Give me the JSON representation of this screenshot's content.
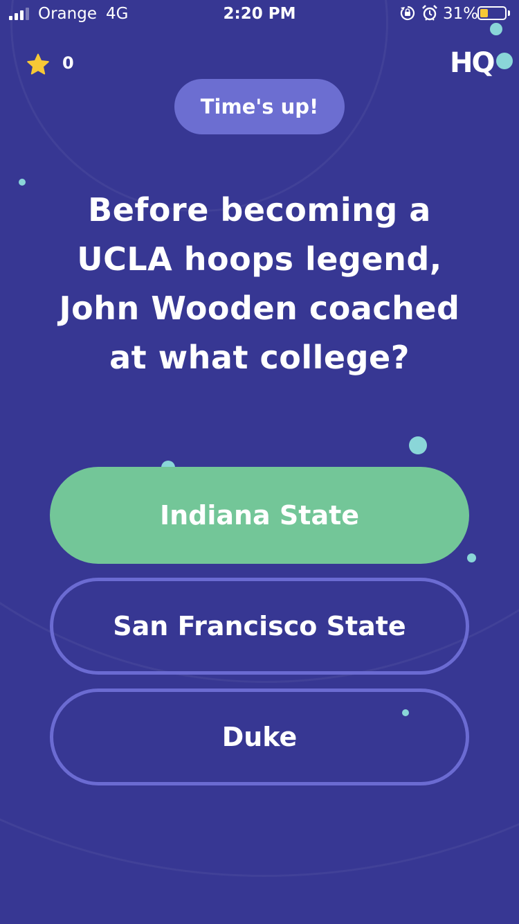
{
  "status_bar": {
    "carrier": "Orange",
    "network": "4G",
    "time": "2:20 PM",
    "battery_percent": "31%",
    "battery_level": 0.31,
    "signal_bars": 3,
    "icons": [
      "signal-icon",
      "orientation-lock-icon",
      "alarm-icon",
      "battery-icon"
    ]
  },
  "header": {
    "score": "0",
    "star_icon": "star-icon",
    "logo": "HQ"
  },
  "timer_badge": "Time's up!",
  "question": "Before becoming a UCLA hoops legend, John Wooden coached at what college?",
  "answers": [
    {
      "label": "Indiana State",
      "state": "correct"
    },
    {
      "label": "San Francisco State",
      "state": "unselected"
    },
    {
      "label": "Duke",
      "state": "unselected"
    }
  ],
  "colors": {
    "background": "#373793",
    "badge": "#6c6ed1",
    "correct_answer": "#73c698",
    "answer_outline": "#6b6bd2",
    "accent_dot": "#8ad6d8",
    "star": "#f7c836"
  }
}
